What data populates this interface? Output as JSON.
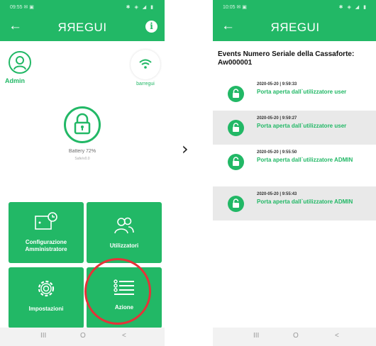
{
  "left_screen": {
    "status_time": "09:55 ✉ ▣",
    "status_icons": "✱ ◈ ◢ ▮",
    "app_logo": "ЯЯEGUI",
    "user_label": "Admin",
    "device_name": "barregui",
    "battery_text": "Battery 72%",
    "battery_subtext": "Safe/v0.0",
    "tiles": [
      {
        "label": "Configurazione Amministratore",
        "icon": "safe-settings-icon"
      },
      {
        "label": "Utilizzatori",
        "icon": "users-icon"
      },
      {
        "label": "Impostazioni",
        "icon": "gear-icon"
      },
      {
        "label": "Azione",
        "icon": "list-icon"
      }
    ]
  },
  "right_screen": {
    "status_time": "10:05 ✉ ▣",
    "status_icons": "✱ ◈ ◢ ▮",
    "app_logo": "ЯЯEGUI",
    "events_title": "Events Numero Seriale della Cassaforte: Aw000001",
    "events": [
      {
        "datetime": "2020-05-20 | 9:59:33",
        "message": "Porta aperta dall`utilizzatore user"
      },
      {
        "datetime": "2020-05-20 | 9:59:27",
        "message": "Porta aperta dall`utilizzatore user"
      },
      {
        "datetime": "2020-05-20 | 9:55:50",
        "message": "Porta aperta dall`utilizzatore ADMIN"
      },
      {
        "datetime": "2020-05-20 | 9:55:43",
        "message": "Porta aperta dall`utilizzatore ADMIN"
      }
    ]
  },
  "navbar": {
    "recent": "III",
    "home": "O",
    "back": "<"
  },
  "arrow_between": "›",
  "colors": {
    "brand_green": "#22b866",
    "highlight_red": "#e53238",
    "row_shade": "#e9e9e9"
  }
}
